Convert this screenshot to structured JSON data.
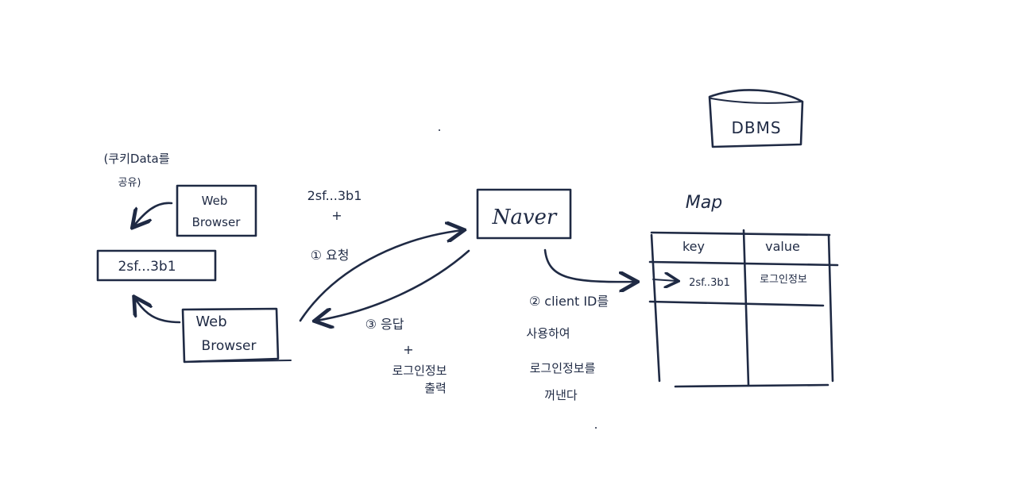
{
  "diagram": {
    "dbms_label": "DBMS",
    "map_title": "Map",
    "map_headers": {
      "key": "key",
      "value": "value"
    },
    "map_row": {
      "key": "2sf..3b1",
      "value": "로그인정보"
    },
    "server_label": "Naver",
    "browser_top": {
      "line1": "Web",
      "line2": "Browser"
    },
    "browser_bottom": {
      "line1": "Web",
      "line2": "Browser"
    },
    "cookie_value": "2sf...3b1",
    "cookie_note": {
      "line1": "(쿠키Data를",
      "line2": "공유)"
    },
    "request_note": {
      "line1": "2sf...3b1",
      "line2": "+",
      "line3": "① 요청"
    },
    "response_note": {
      "line1": "③ 응답",
      "line2": "+",
      "line3": "로그인정보",
      "line4": "출력"
    },
    "server_note": {
      "line1": "② client ID를",
      "line2": "사용하여",
      "line3": "로그인정보를",
      "line4": "꺼낸다"
    }
  }
}
